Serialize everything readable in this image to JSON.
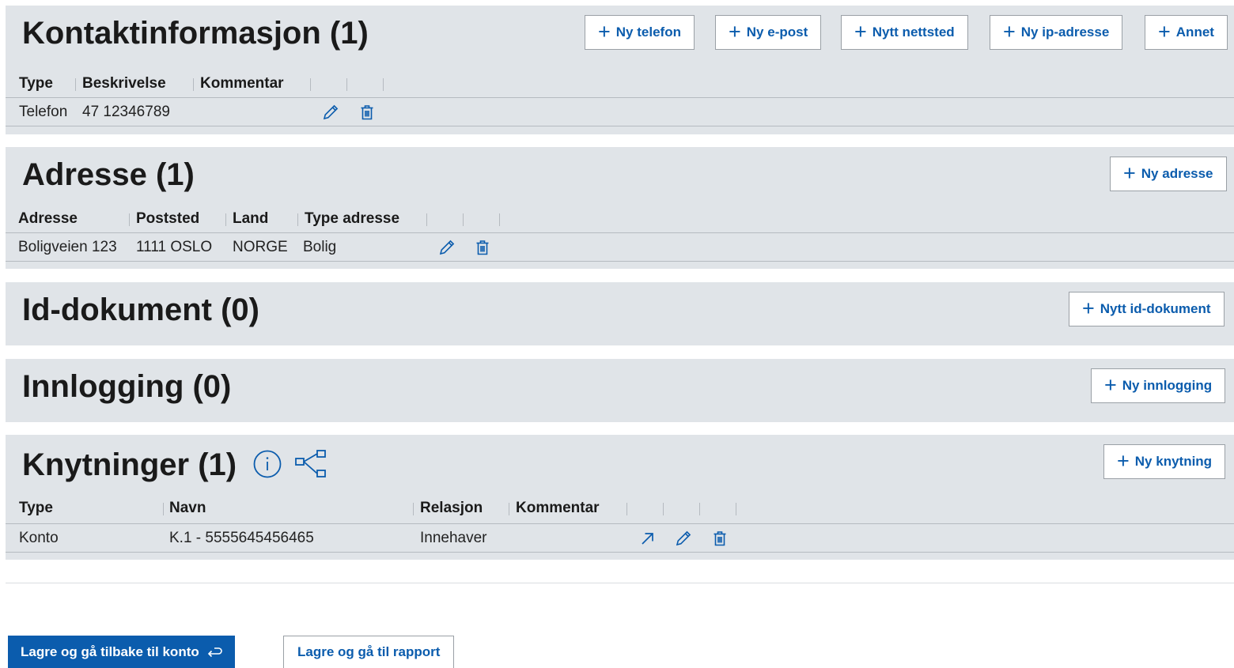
{
  "kontakt": {
    "title": "Kontaktinformasjon (1)",
    "buttons": [
      "Ny telefon",
      "Ny e-post",
      "Nytt nettsted",
      "Ny ip-adresse",
      "Annet"
    ],
    "headers": [
      "Type",
      "Beskrivelse",
      "Kommentar"
    ],
    "rows": [
      {
        "type": "Telefon",
        "beskrivelse": "47 12346789",
        "kommentar": ""
      }
    ]
  },
  "adresse": {
    "title": "Adresse (1)",
    "button": "Ny adresse",
    "headers": [
      "Adresse",
      "Poststed",
      "Land",
      "Type adresse"
    ],
    "rows": [
      {
        "adresse": "Boligveien 123",
        "poststed": "1111 OSLO",
        "land": "NORGE",
        "type": "Bolig"
      }
    ]
  },
  "id_dokument": {
    "title": "Id-dokument (0)",
    "button": "Nytt id-dokument"
  },
  "innlogging": {
    "title": "Innlogging (0)",
    "button": "Ny innlogging"
  },
  "knytninger": {
    "title": "Knytninger (1)",
    "button": "Ny knytning",
    "headers": [
      "Type",
      "Navn",
      "Relasjon",
      "Kommentar"
    ],
    "rows": [
      {
        "type": "Konto",
        "navn": "K.1 - 5555645456465",
        "relasjon": "Innehaver",
        "kommentar": ""
      }
    ]
  },
  "footer": {
    "primary": "Lagre og gå tilbake til konto",
    "secondary": "Lagre og gå til rapport"
  },
  "colors": {
    "accent": "#0b5cad",
    "panel_bg": "#e0e4e8"
  },
  "icons": [
    "plus-icon",
    "edit-icon",
    "delete-icon",
    "info-icon",
    "network-icon",
    "open-arrow-icon",
    "return-arrow-icon"
  ]
}
